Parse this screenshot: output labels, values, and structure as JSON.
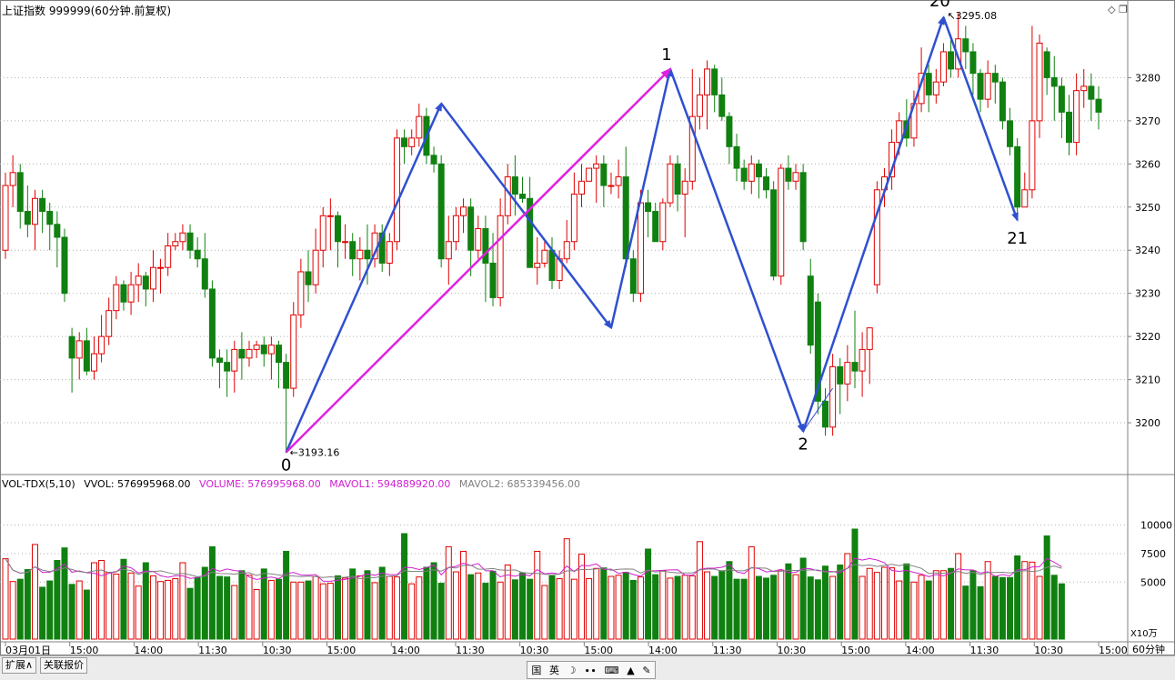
{
  "header": {
    "title": "上证指数 999999(60分钟.前复权)",
    "icons": [
      "diamond-icon",
      "restore-window-icon"
    ]
  },
  "volume_header": {
    "indicator": "VOL-TDX(5,10)",
    "vvol": "VVOL: 576995968.00",
    "volume": "VOLUME: 576995968.00",
    "mavol1": "MAVOL1: 594889920.00",
    "mavol2": "MAVOL2: 685339456.00",
    "unit": "X10万"
  },
  "colors": {
    "up": "#e00000",
    "down": "#108010",
    "arrow": "#2f50d0",
    "magenta_line": "#e020e0",
    "mavol1": "#d020d0",
    "mavol2": "#808080",
    "grid": "#b0b0b0",
    "axis_text": "#000000"
  },
  "chart_data": {
    "type": "candlestick",
    "period_label": "60分钟",
    "price_axis": {
      "ticks": [
        3200,
        3210,
        3220,
        3230,
        3240,
        3250,
        3260,
        3270,
        3280
      ],
      "range": [
        3188,
        3298
      ]
    },
    "volume_axis": {
      "ticks": [
        5000,
        7500,
        10000
      ],
      "labels": [
        "5000",
        "7500",
        "10000"
      ],
      "range": [
        0,
        13000
      ]
    },
    "time_labels": [
      "03月01日",
      "15:00",
      "14:00",
      "11:30",
      "10:30",
      "15:00",
      "14:00",
      "11:30",
      "10:30",
      "15:00",
      "14:00",
      "11:30",
      "10:30",
      "15:00",
      "14:00",
      "11:30",
      "10:30",
      "15:00"
    ],
    "candles": [
      [
        3240,
        3255,
        3238,
        3258
      ],
      [
        3255,
        3258,
        3250,
        3262
      ],
      [
        3258,
        3249,
        3245,
        3260
      ],
      [
        3249,
        3246,
        3243,
        3255
      ],
      [
        3246,
        3252,
        3240,
        3254
      ],
      [
        3252,
        3249,
        3244,
        3254
      ],
      [
        3249,
        3246,
        3240,
        3251
      ],
      [
        3246,
        3243,
        3236,
        3249
      ],
      [
        3243,
        3230,
        3228,
        3245
      ],
      [
        3220,
        3215,
        3207,
        3222
      ],
      [
        3215,
        3219,
        3210,
        3221
      ],
      [
        3219,
        3212,
        3211,
        3222
      ],
      [
        3212,
        3216,
        3210,
        3220
      ],
      [
        3216,
        3220,
        3214,
        3225
      ],
      [
        3220,
        3226,
        3218,
        3229
      ],
      [
        3226,
        3232,
        3224,
        3234
      ],
      [
        3232,
        3228,
        3226,
        3233
      ],
      [
        3228,
        3232,
        3225,
        3235
      ],
      [
        3232,
        3234,
        3228,
        3237
      ],
      [
        3234,
        3231,
        3227,
        3235
      ],
      [
        3231,
        3236,
        3228,
        3240
      ],
      [
        3236,
        3236,
        3230,
        3238
      ],
      [
        3236,
        3241,
        3234,
        3244
      ],
      [
        3241,
        3242,
        3240,
        3244
      ],
      [
        3242,
        3244,
        3240,
        3246
      ],
      [
        3244,
        3240,
        3238,
        3246
      ],
      [
        3240,
        3238,
        3236,
        3243
      ],
      [
        3238,
        3231,
        3229,
        3244
      ],
      [
        3231,
        3215,
        3213,
        3233
      ],
      [
        3215,
        3214,
        3208,
        3217
      ],
      [
        3214,
        3212,
        3206,
        3217
      ],
      [
        3212,
        3217,
        3207,
        3219
      ],
      [
        3217,
        3215,
        3210,
        3221
      ],
      [
        3215,
        3217,
        3213,
        3219
      ],
      [
        3217,
        3218,
        3215,
        3219
      ],
      [
        3218,
        3216,
        3213,
        3220
      ],
      [
        3216,
        3218,
        3210,
        3220
      ],
      [
        3218,
        3214,
        3208,
        3219
      ],
      [
        3214,
        3208,
        3193,
        3216
      ],
      [
        3208,
        3225,
        3206,
        3228
      ],
      [
        3225,
        3235,
        3222,
        3238
      ],
      [
        3235,
        3232,
        3228,
        3240
      ],
      [
        3232,
        3240,
        3230,
        3245
      ],
      [
        3240,
        3248,
        3236,
        3250
      ],
      [
        3248,
        3248,
        3240,
        3252
      ],
      [
        3248,
        3242,
        3236,
        3249
      ],
      [
        3242,
        3242,
        3238,
        3246
      ],
      [
        3242,
        3238,
        3234,
        3244
      ],
      [
        3238,
        3240,
        3233,
        3243
      ],
      [
        3240,
        3238,
        3232,
        3246
      ],
      [
        3238,
        3244,
        3236,
        3246
      ],
      [
        3244,
        3237,
        3235,
        3246
      ],
      [
        3237,
        3242,
        3234,
        3244
      ],
      [
        3242,
        3266,
        3240,
        3268
      ],
      [
        3266,
        3264,
        3260,
        3268
      ],
      [
        3264,
        3266,
        3262,
        3268
      ],
      [
        3266,
        3271,
        3264,
        3274
      ],
      [
        3271,
        3262,
        3260,
        3273
      ],
      [
        3262,
        3260,
        3258,
        3264
      ],
      [
        3260,
        3238,
        3236,
        3262
      ],
      [
        3238,
        3242,
        3232,
        3248
      ],
      [
        3242,
        3248,
        3240,
        3250
      ],
      [
        3248,
        3250,
        3244,
        3252
      ],
      [
        3250,
        3240,
        3234,
        3252
      ],
      [
        3240,
        3245,
        3238,
        3248
      ],
      [
        3245,
        3237,
        3228,
        3248
      ],
      [
        3237,
        3229,
        3227,
        3244
      ],
      [
        3229,
        3248,
        3227,
        3252
      ],
      [
        3248,
        3257,
        3246,
        3260
      ],
      [
        3257,
        3253,
        3248,
        3262
      ],
      [
        3253,
        3252,
        3251,
        3257
      ],
      [
        3252,
        3236,
        3236,
        3257
      ],
      [
        3236,
        3237,
        3232,
        3243
      ],
      [
        3237,
        3240,
        3236,
        3242
      ],
      [
        3240,
        3233,
        3231,
        3243
      ],
      [
        3233,
        3238,
        3231,
        3240
      ],
      [
        3238,
        3242,
        3237,
        3247
      ],
      [
        3242,
        3253,
        3240,
        3258
      ],
      [
        3253,
        3256,
        3250,
        3260
      ],
      [
        3256,
        3259,
        3256,
        3259
      ],
      [
        3259,
        3260,
        3251,
        3262
      ],
      [
        3260,
        3255,
        3250,
        3262
      ],
      [
        3255,
        3255,
        3253,
        3258
      ],
      [
        3255,
        3257,
        3252,
        3261
      ],
      [
        3257,
        3238,
        3236,
        3264
      ],
      [
        3238,
        3230,
        3228,
        3240
      ],
      [
        3230,
        3251,
        3228,
        3254
      ],
      [
        3251,
        3249,
        3243,
        3254
      ],
      [
        3249,
        3242,
        3242,
        3251
      ],
      [
        3242,
        3251,
        3240,
        3252
      ],
      [
        3251,
        3260,
        3250,
        3262
      ],
      [
        3260,
        3253,
        3249,
        3262
      ],
      [
        3253,
        3256,
        3243,
        3259
      ],
      [
        3256,
        3271,
        3254,
        3282
      ],
      [
        3271,
        3276,
        3268,
        3280
      ],
      [
        3276,
        3282,
        3268,
        3284
      ],
      [
        3282,
        3276,
        3272,
        3283
      ],
      [
        3276,
        3271,
        3270,
        3280
      ],
      [
        3271,
        3264,
        3260,
        3272
      ],
      [
        3264,
        3259,
        3256,
        3267
      ],
      [
        3259,
        3256,
        3254,
        3261
      ],
      [
        3256,
        3260,
        3253,
        3262
      ],
      [
        3260,
        3257,
        3252,
        3261
      ],
      [
        3257,
        3254,
        3252,
        3259
      ],
      [
        3254,
        3234,
        3233,
        3256
      ],
      [
        3234,
        3259,
        3232,
        3260
      ],
      [
        3259,
        3256,
        3254,
        3262
      ],
      [
        3256,
        3258,
        3254,
        3260
      ],
      [
        3258,
        3242,
        3240,
        3260
      ],
      [
        3234,
        3218,
        3216,
        3238
      ],
      [
        3228,
        3205,
        3202,
        3230
      ],
      [
        3205,
        3199,
        3197,
        3208
      ],
      [
        3199,
        3213,
        3197,
        3216
      ],
      [
        3213,
        3209,
        3202,
        3215
      ],
      [
        3209,
        3214,
        3205,
        3218
      ],
      [
        3214,
        3212,
        3208,
        3226
      ],
      [
        3212,
        3217,
        3206,
        3221
      ],
      [
        3217,
        3222,
        3209,
        3222
      ],
      [
        3232,
        3254,
        3230,
        3256
      ],
      [
        3254,
        3257,
        3250,
        3259
      ],
      [
        3257,
        3265,
        3254,
        3268
      ],
      [
        3265,
        3270,
        3262,
        3272
      ],
      [
        3270,
        3266,
        3264,
        3275
      ],
      [
        3266,
        3274,
        3264,
        3277
      ],
      [
        3274,
        3281,
        3272,
        3287
      ],
      [
        3281,
        3276,
        3272,
        3283
      ],
      [
        3276,
        3279,
        3274,
        3282
      ],
      [
        3279,
        3286,
        3278,
        3288
      ],
      [
        3286,
        3282,
        3280,
        3290
      ],
      [
        3282,
        3289,
        3280,
        3295
      ],
      [
        3289,
        3286,
        3282,
        3292
      ],
      [
        3286,
        3281,
        3276,
        3288
      ],
      [
        3281,
        3275,
        3272,
        3282
      ],
      [
        3275,
        3281,
        3273,
        3284
      ],
      [
        3281,
        3279,
        3274,
        3283
      ],
      [
        3279,
        3270,
        3268,
        3280
      ],
      [
        3270,
        3264,
        3262,
        3273
      ],
      [
        3264,
        3250,
        3248,
        3266
      ],
      [
        3250,
        3254,
        3250,
        3258
      ],
      [
        3254,
        3270,
        3252,
        3292
      ],
      [
        3270,
        3288,
        3266,
        3290
      ],
      [
        3286,
        3280,
        3276,
        3287
      ],
      [
        3280,
        3278,
        3270,
        3285
      ],
      [
        3278,
        3272,
        3266,
        3280
      ],
      [
        3272,
        3265,
        3262,
        3276
      ],
      [
        3265,
        3277,
        3262,
        3281
      ],
      [
        3277,
        3278,
        3273,
        3282
      ],
      [
        3278,
        3275,
        3270,
        3281
      ],
      [
        3275,
        3272,
        3268,
        3278
      ]
    ],
    "volumes": [
      7050,
      5050,
      5250,
      6100,
      8300,
      4550,
      5100,
      6900,
      8000,
      4800,
      5100,
      4300,
      6700,
      6900,
      5850,
      5700,
      7000,
      5800,
      4650,
      6700,
      5550,
      5050,
      5150,
      5300,
      6700,
      4450,
      5400,
      6300,
      8100,
      5500,
      5450,
      4700,
      6000,
      5600,
      4350,
      6150,
      5150,
      5250,
      7700,
      5000,
      5000,
      5100,
      5500,
      4850,
      4900,
      5550,
      5350,
      6150,
      5550,
      6000,
      4950,
      6300,
      5500,
      5450,
      9250,
      4850,
      5450,
      6300,
      6700,
      4900,
      8100,
      5900,
      7700,
      5650,
      5800,
      4900,
      5950,
      5000,
      6500,
      5200,
      5800,
      5250,
      7700,
      4700,
      5550,
      5300,
      8800,
      5250,
      7450,
      5300,
      6200,
      6250,
      5500,
      5600,
      5850,
      5150,
      5450,
      7900,
      5650,
      6000,
      5350,
      5500,
      5600,
      5550,
      8550,
      5900,
      5500,
      6000,
      6800,
      5250,
      5250,
      8100,
      5500,
      5350,
      5600,
      6050,
      6600,
      5650,
      7100,
      5450,
      5200,
      6400,
      5500,
      6500,
      7500,
      9650,
      5500,
      6200,
      5850,
      6300,
      6250,
      5100,
      6600,
      5000,
      5600,
      5100,
      6000,
      6000,
      6200,
      7500,
      4650,
      6000,
      4600,
      6800,
      5500,
      5400,
      5400,
      7300,
      6800,
      6750,
      5500,
      9050,
      5600,
      4850
    ],
    "annotations": {
      "high_price": "3295.08",
      "low_price": "3193.16",
      "wave_labels": [
        "0",
        "1",
        "2",
        "20",
        "21"
      ]
    }
  },
  "statusbar": {
    "tab1": "扩展∧",
    "tab2": "关联报价",
    "ime_items": [
      "国",
      "英",
      "☽",
      "∙∙",
      "⌨",
      "▲",
      "✎"
    ]
  }
}
